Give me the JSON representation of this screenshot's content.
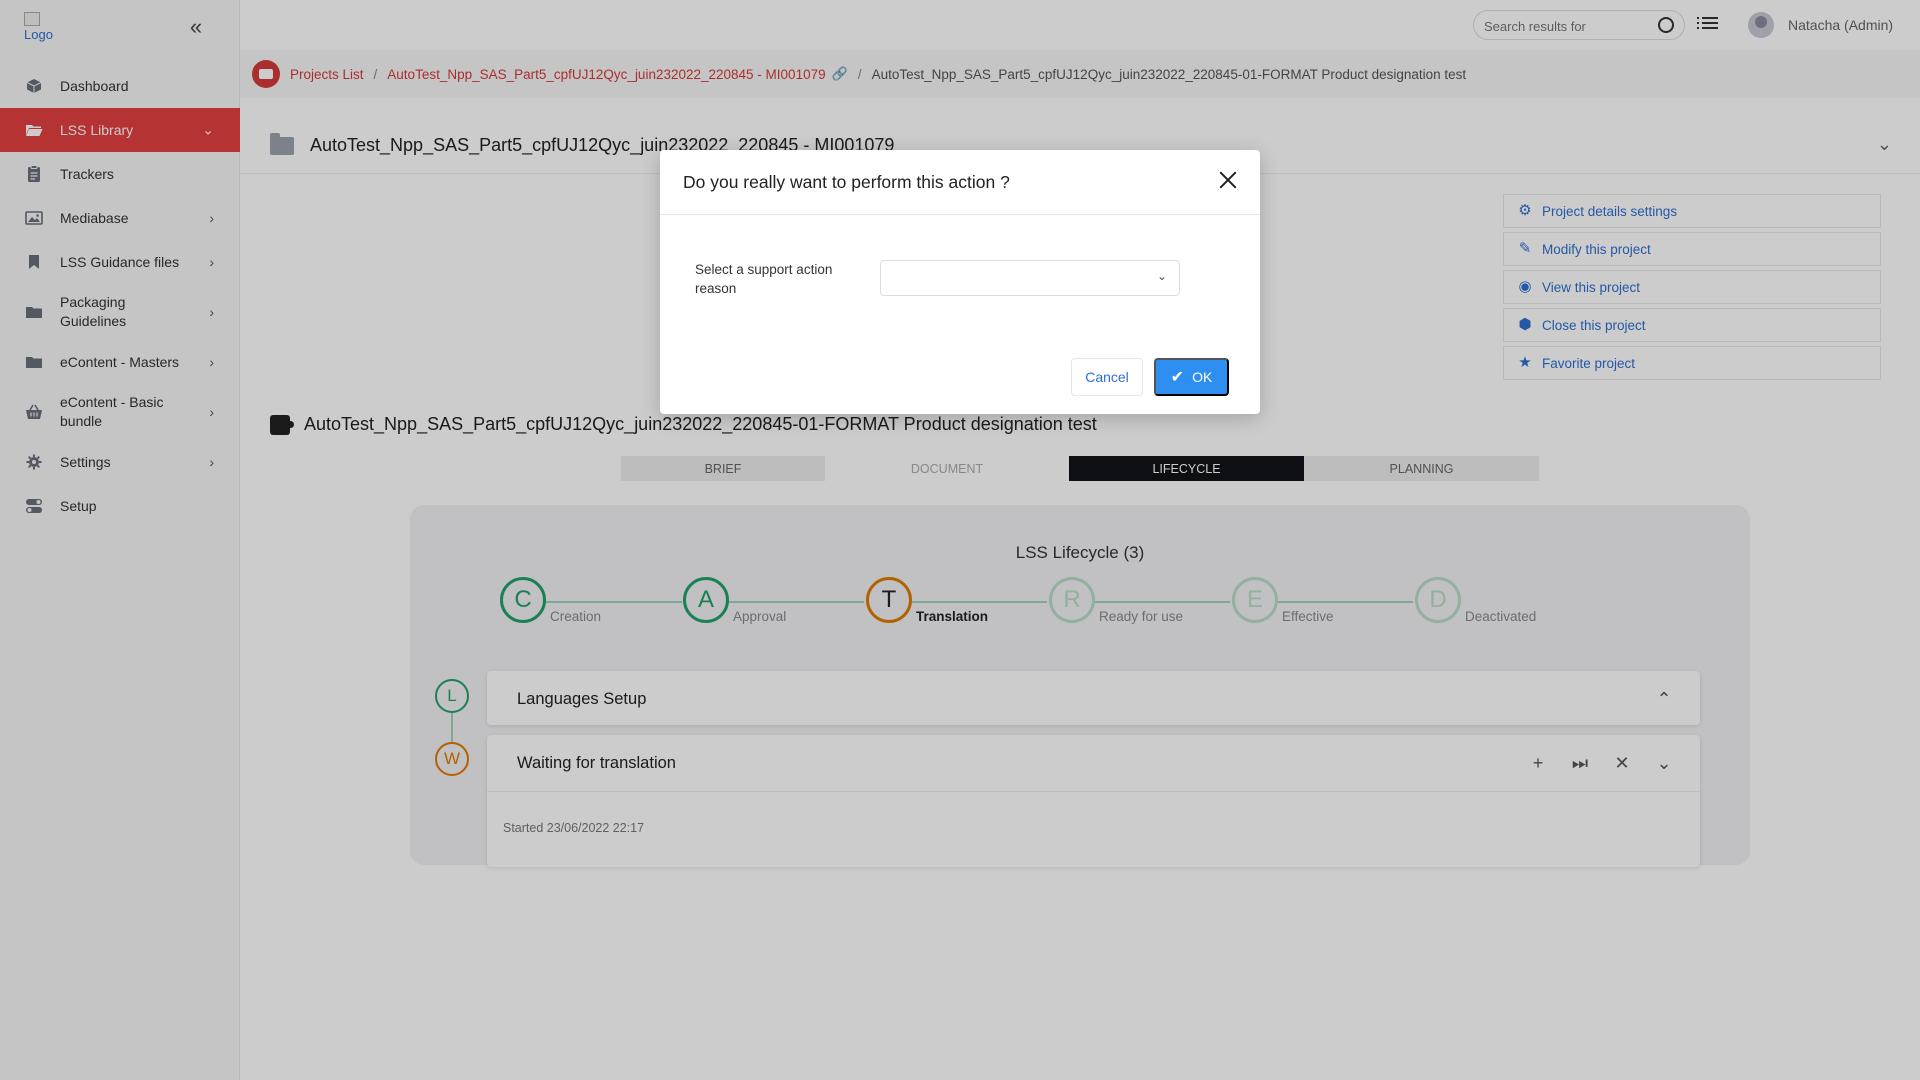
{
  "app": {
    "logo_alt": "Logo"
  },
  "sidebar": {
    "items": [
      {
        "label": "Dashboard",
        "icon": "cube-icon"
      },
      {
        "label": "LSS Library",
        "icon": "folder-open-icon",
        "active": true,
        "has_chevron": true
      },
      {
        "label": "Trackers",
        "icon": "clipboard-icon"
      },
      {
        "label": "Mediabase",
        "icon": "image-icon",
        "has_chevron": true
      },
      {
        "label": "LSS Guidance files",
        "icon": "bookmark-icon",
        "has_chevron": true
      },
      {
        "label": "Packaging Guidelines",
        "icon": "folder-icon",
        "has_chevron": true
      },
      {
        "label": "eContent - Masters",
        "icon": "folder-icon",
        "has_chevron": true
      },
      {
        "label": "eContent - Basic bundle",
        "icon": "basket-icon",
        "has_chevron": true
      },
      {
        "label": "Settings",
        "icon": "gear-icon",
        "has_chevron": true
      },
      {
        "label": "Setup",
        "icon": "toggle-icon"
      }
    ]
  },
  "topbar": {
    "search_placeholder": "Search results for",
    "user_name": "Natacha (Admin)"
  },
  "breadcrumb": {
    "projects_list": "Projects List",
    "project": "AutoTest_Npp_SAS_Part5_cpfUJ12Qyc_juin232022_220845 - MI001079",
    "current": "AutoTest_Npp_SAS_Part5_cpfUJ12Qyc_juin232022_220845-01-FORMAT Product designation test"
  },
  "project": {
    "title": "AutoTest_Npp_SAS_Part5_cpfUJ12Qyc_juin232022_220845 - MI001079"
  },
  "actions": [
    {
      "label": "Project details settings",
      "icon": "gear-icon"
    },
    {
      "label": "Modify this project",
      "icon": "edit-icon"
    },
    {
      "label": "View this project",
      "icon": "eye-icon"
    },
    {
      "label": "Close this project",
      "icon": "box-icon"
    },
    {
      "label": "Favorite project",
      "icon": "star-icon"
    }
  ],
  "document": {
    "title": "AutoTest_Npp_SAS_Part5_cpfUJ12Qyc_juin232022_220845-01-FORMAT Product designation test",
    "tabs": [
      "BRIEF",
      "DOCUMENT",
      "LIFECYCLE",
      "PLANNING"
    ],
    "active_tab": "LIFECYCLE"
  },
  "lifecycle": {
    "title": "LSS Lifecycle (3)",
    "stages": [
      {
        "letter": "C",
        "label": "Creation",
        "state": "done"
      },
      {
        "letter": "A",
        "label": "Approval",
        "state": "done"
      },
      {
        "letter": "T",
        "label": "Translation",
        "state": "current"
      },
      {
        "letter": "R",
        "label": "Ready for use",
        "state": "pending"
      },
      {
        "letter": "E",
        "label": "Effective",
        "state": "pending"
      },
      {
        "letter": "D",
        "label": "Deactivated",
        "state": "pending"
      }
    ],
    "steps": [
      {
        "letter": "L",
        "title": "Languages Setup"
      },
      {
        "letter": "W",
        "title": "Waiting for translation",
        "started": "Started 23/06/2022 22:17"
      }
    ]
  },
  "modal": {
    "title": "Do you really want to perform this action ?",
    "field_label": "Select a support action reason",
    "select_value": "",
    "cancel_label": "Cancel",
    "ok_label": "OK"
  },
  "colors": {
    "accent_red": "#e34040",
    "link_blue": "#2f6fd1",
    "ok_blue": "#2f8ff0",
    "stage_green": "#22a06b",
    "stage_orange": "#e07b00",
    "stage_pending": "#9dd4b8"
  }
}
